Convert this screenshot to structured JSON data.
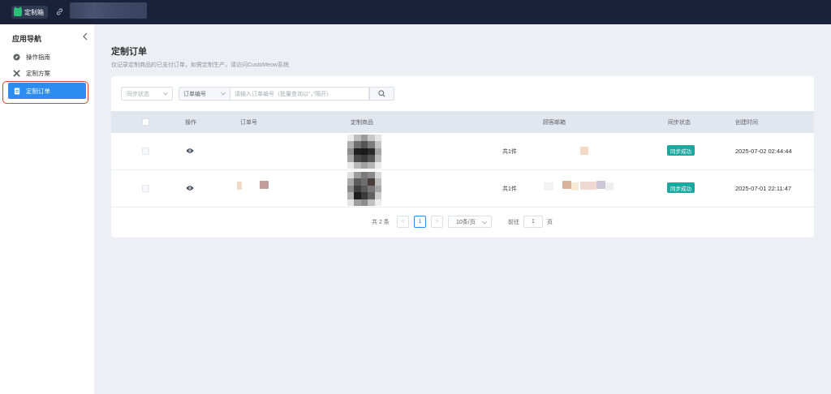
{
  "header": {
    "app_name": "定制箱"
  },
  "sidebar": {
    "title": "应用导航",
    "items": [
      {
        "label": "操作指南",
        "icon": "compass-icon"
      },
      {
        "label": "定制方案",
        "icon": "tools-icon"
      },
      {
        "label": "定制订单",
        "icon": "document-icon",
        "active": true
      }
    ]
  },
  "page": {
    "title": "定制订单",
    "subtitle": "仅记录定制商品的已支付订单，如需定制生产，请访问CustoMeow系统"
  },
  "filters": {
    "status_placeholder": "同步状态",
    "field_select": "订单编号",
    "search_placeholder": "请输入订单编号（批量查询以“，”隔开）"
  },
  "table": {
    "columns": [
      "操作",
      "订单号",
      "定制商品",
      "顾客邮箱",
      "同步状态",
      "创建时间"
    ],
    "rows": [
      {
        "count": "共1件",
        "status": "同步成功",
        "created": "2025-07-02 02:44:44"
      },
      {
        "count": "共1件",
        "status": "同步成功",
        "created": "2025-07-01 22:11:47"
      }
    ]
  },
  "pagination": {
    "total": "共 2 条",
    "prev": "<",
    "current_page": "1",
    "next": ">",
    "page_size": "10条/页",
    "goto_label": "前往",
    "goto_value": "1",
    "goto_unit": "页"
  },
  "colors": {
    "topbar": "#19223a",
    "accent": "#2d8cf0",
    "success_badge": "#1aa9a0",
    "highlight_border": "#d9472b"
  }
}
